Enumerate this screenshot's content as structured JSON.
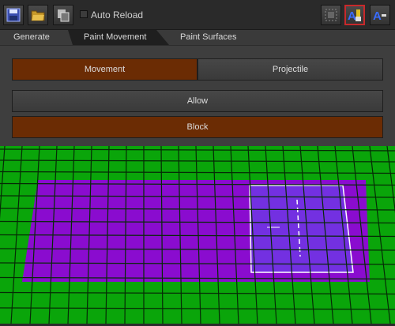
{
  "toolbar": {
    "auto_reload_label": "Auto Reload",
    "auto_reload_checked": false,
    "icons": [
      "save-icon",
      "open-folder-icon",
      "copy-icon",
      "grid-icon",
      "text-paint-icon",
      "text-paint-alt-icon"
    ]
  },
  "tabs": [
    {
      "label": "Generate",
      "active": false
    },
    {
      "label": "Paint Movement",
      "active": true
    },
    {
      "label": "Paint Surfaces",
      "active": false
    }
  ],
  "panel": {
    "movement_label": "Movement",
    "projectile_label": "Projectile",
    "allow_label": "Allow",
    "block_label": "Block"
  },
  "colors": {
    "accent": "#6b2c04",
    "grid_green": "#0aa50a",
    "paint_purple": "#8a0ccf",
    "selection": "#6a40e8",
    "highlight_border": "#c8292b"
  }
}
